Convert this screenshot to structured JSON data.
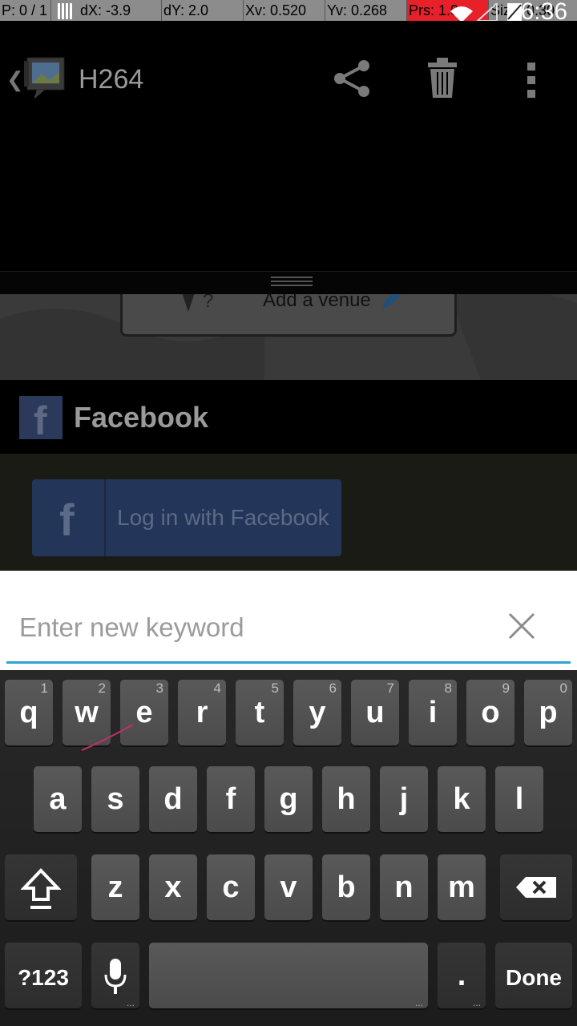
{
  "debug_bar": {
    "p": "P: 0 / 1",
    "dx": "dX: -3.9",
    "dy": "dY: 2.0",
    "xv": "Xv: 0.520",
    "yv": "Yv: 0.268",
    "prs": "Prs: 1.0",
    "size": "Size: 0.30"
  },
  "status_bar": {
    "time": "6:36"
  },
  "action_bar": {
    "title": "H264",
    "share_icon": "share-icon",
    "delete_icon": "trash-icon",
    "overflow_icon": "overflow-menu-icon"
  },
  "background_content": {
    "venue_button_label": "Add a venue",
    "facebook_header": "Facebook",
    "facebook_login_label": "Log in with Facebook"
  },
  "search": {
    "placeholder": "Enter new keyword",
    "value": ""
  },
  "keyboard": {
    "row1": [
      {
        "label": "q",
        "hint": "1"
      },
      {
        "label": "w",
        "hint": "2"
      },
      {
        "label": "e",
        "hint": "3"
      },
      {
        "label": "r",
        "hint": "4"
      },
      {
        "label": "t",
        "hint": "5"
      },
      {
        "label": "y",
        "hint": "6"
      },
      {
        "label": "u",
        "hint": "7"
      },
      {
        "label": "i",
        "hint": "8"
      },
      {
        "label": "o",
        "hint": "9"
      },
      {
        "label": "p",
        "hint": "0"
      }
    ],
    "row2": [
      "a",
      "s",
      "d",
      "f",
      "g",
      "h",
      "j",
      "k",
      "l"
    ],
    "row3": [
      "z",
      "x",
      "c",
      "v",
      "b",
      "n",
      "m"
    ],
    "symbols_label": "?123",
    "period_label": ".",
    "done_label": "Done",
    "more_hint": "..."
  },
  "colors": {
    "accent_underline": "#33a0d3",
    "debug_prs_bg": "#e8202a",
    "facebook_blue": "#233559"
  }
}
